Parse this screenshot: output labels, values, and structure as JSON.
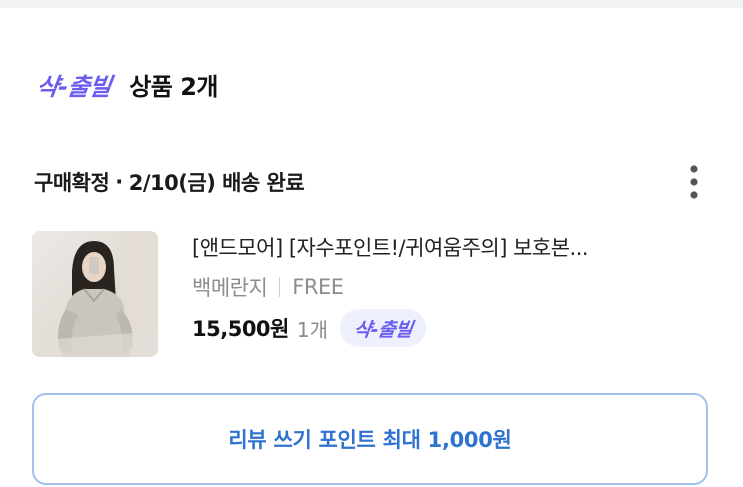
{
  "group": {
    "brand_label": "샥-출빌",
    "title": "상품 2개"
  },
  "order": {
    "status_text": "구매확정",
    "separator": "·",
    "delivery_text": "2/10(금) 배송 완료"
  },
  "more_menu": {
    "icon": "more-vertical-icon"
  },
  "product": {
    "thumbnail_icon": "product-photo",
    "name": "[앤드모어] [자수포인트!/귀여움주의] 보호본...",
    "color": "백메란지",
    "size": "FREE",
    "price": "15,500원",
    "quantity": "1개",
    "delivery_badge": "샥-출빌"
  },
  "review_button": {
    "label": "리뷰 쓰기 포인트 최대 1,000원"
  },
  "colors": {
    "brand_purple": "#6a5df0",
    "badge_bg": "#eef0fd",
    "review_blue": "#2f73cf",
    "review_border": "#9fc1ec"
  }
}
